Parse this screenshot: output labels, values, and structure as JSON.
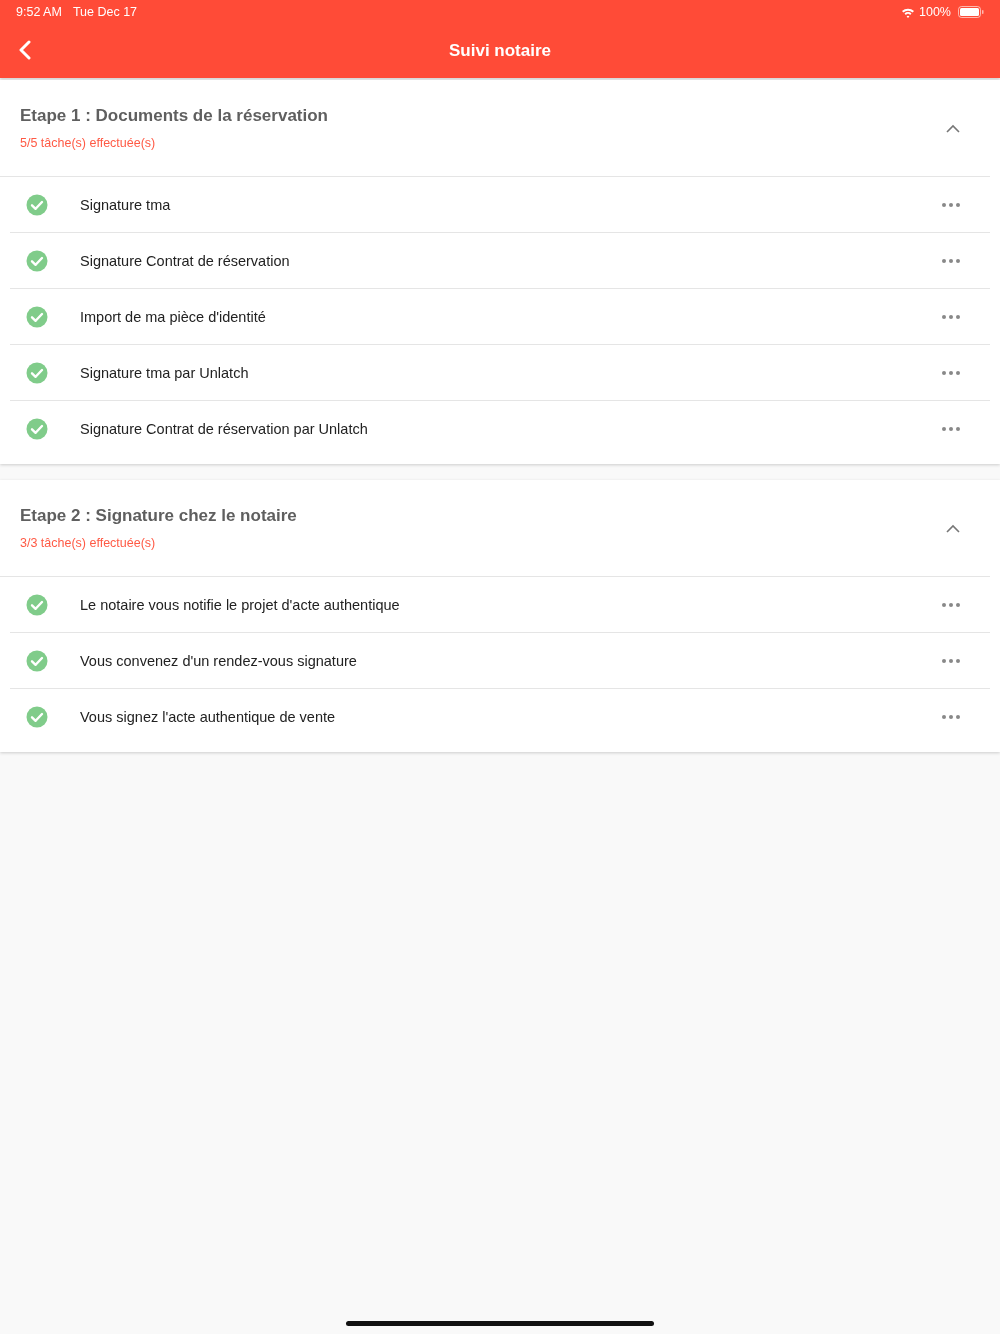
{
  "status_bar": {
    "time": "9:52 AM",
    "date": "Tue Dec 17",
    "battery": "100%"
  },
  "header": {
    "title": "Suivi notaire"
  },
  "sections": [
    {
      "title": "Etape 1 : Documents de la réservation",
      "progress": "5/5 tâche(s) effectuée(s)",
      "expanded": true,
      "tasks": [
        {
          "label": "Signature tma",
          "done": true
        },
        {
          "label": "Signature Contrat de réservation",
          "done": true
        },
        {
          "label": "Import de ma pièce d'identité",
          "done": true
        },
        {
          "label": "Signature tma par Unlatch",
          "done": true
        },
        {
          "label": "Signature Contrat de réservation par Unlatch",
          "done": true
        }
      ]
    },
    {
      "title": "Etape 2 : Signature chez le notaire",
      "progress": "3/3 tâche(s) effectuée(s)",
      "expanded": true,
      "tasks": [
        {
          "label": "Le notaire vous notifie le projet d'acte authentique",
          "done": true
        },
        {
          "label": "Vous convenez d'un rendez-vous signature",
          "done": true
        },
        {
          "label": "Vous signez l'acte authentique de vente",
          "done": true
        }
      ]
    }
  ]
}
